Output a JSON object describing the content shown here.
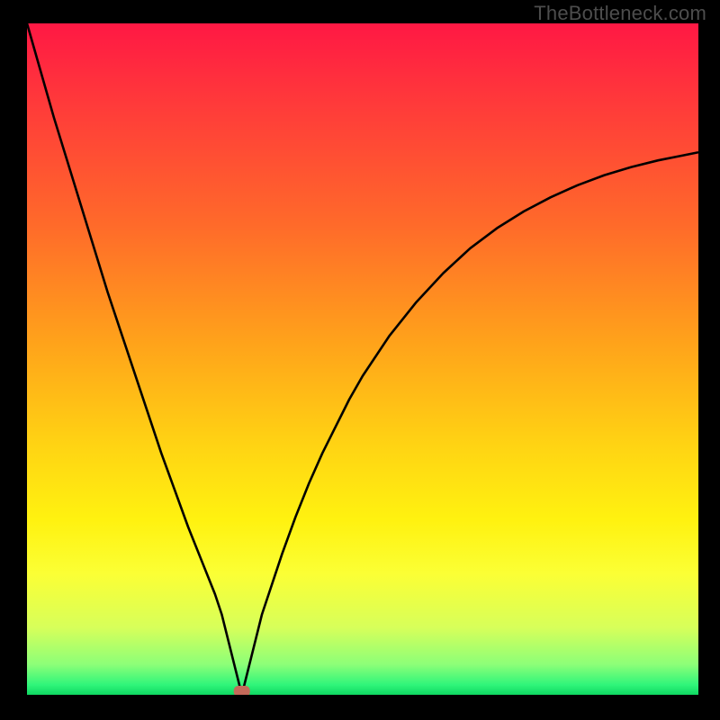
{
  "watermark": "TheBottleneck.com",
  "chart_data": {
    "type": "line",
    "title": "",
    "xlabel": "",
    "ylabel": "",
    "xlim": [
      0,
      100
    ],
    "ylim": [
      0,
      100
    ],
    "grid": false,
    "legend": "none",
    "minimum_marker": {
      "x": 32,
      "y": 0
    },
    "series": [
      {
        "name": "curve",
        "x": [
          0,
          2,
          4,
          6,
          8,
          10,
          12,
          14,
          16,
          18,
          20,
          22,
          24,
          26,
          28,
          29,
          30,
          31,
          32,
          33,
          34,
          35,
          36,
          37,
          38,
          40,
          42,
          44,
          46,
          48,
          50,
          54,
          58,
          62,
          66,
          70,
          74,
          78,
          82,
          86,
          90,
          94,
          98,
          100
        ],
        "y": [
          100,
          93,
          86,
          79.5,
          73,
          66.5,
          60,
          54,
          48,
          42,
          36,
          30.5,
          25,
          20,
          15,
          12,
          8,
          4,
          0,
          4,
          8,
          12,
          15,
          18,
          21,
          26.5,
          31.5,
          36,
          40,
          44,
          47.5,
          53.5,
          58.5,
          62.8,
          66.5,
          69.5,
          72,
          74.1,
          75.9,
          77.4,
          78.6,
          79.6,
          80.4,
          80.8
        ]
      }
    ],
    "gradient_stops": [
      {
        "offset": 0.0,
        "color": "#ff1844"
      },
      {
        "offset": 0.12,
        "color": "#ff3a3a"
      },
      {
        "offset": 0.3,
        "color": "#ff6a2a"
      },
      {
        "offset": 0.48,
        "color": "#ffa41a"
      },
      {
        "offset": 0.63,
        "color": "#ffd413"
      },
      {
        "offset": 0.74,
        "color": "#fff210"
      },
      {
        "offset": 0.82,
        "color": "#fbff35"
      },
      {
        "offset": 0.9,
        "color": "#d7ff5a"
      },
      {
        "offset": 0.955,
        "color": "#8cff78"
      },
      {
        "offset": 0.985,
        "color": "#30f57a"
      },
      {
        "offset": 1.0,
        "color": "#0fd862"
      }
    ]
  }
}
